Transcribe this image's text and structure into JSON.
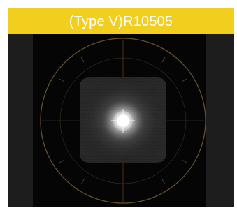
{
  "title": "(Type V)R10505",
  "colors": {
    "title_bar": "#f2cf1f",
    "title_text": "#ffffff",
    "frame_background": "#1d1d1e",
    "image_background": "#050505",
    "spot_center": "#ffffff",
    "grid_ring": "#8a7040"
  },
  "icons": {
    "main_image": "goniophotometer-intensity-plot"
  }
}
